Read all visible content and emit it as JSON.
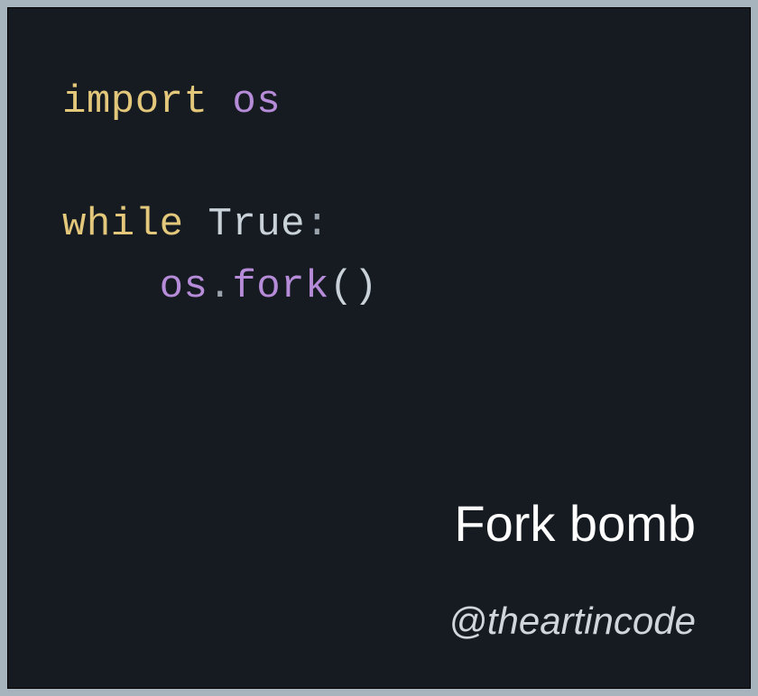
{
  "code": {
    "line1_keyword": "import",
    "line1_module": "os",
    "line3_keyword": "while",
    "line3_cond": "True",
    "line3_colon": ":",
    "indent": "    ",
    "line4_obj": "os",
    "line4_dot": ".",
    "line4_method": "fork",
    "line4_parens": "()"
  },
  "title": "Fork bomb",
  "handle": "@theartincode"
}
